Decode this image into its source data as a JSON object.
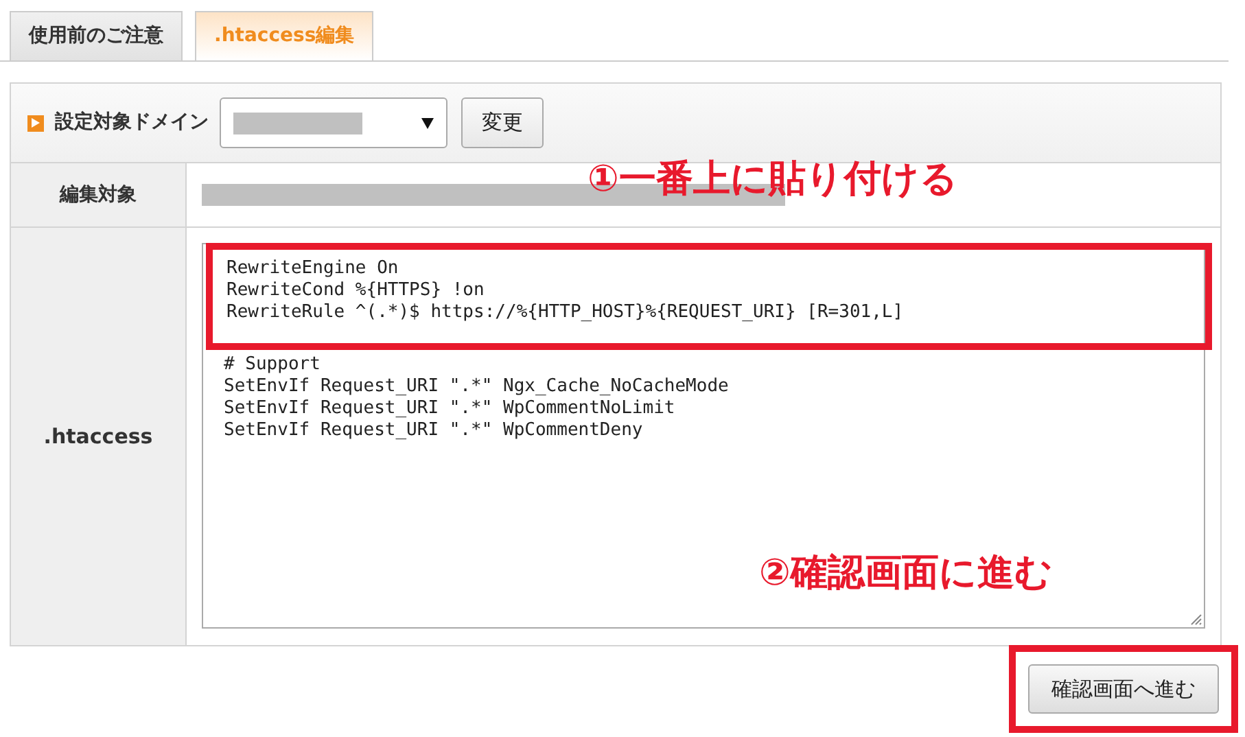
{
  "tabs": [
    {
      "label": "使用前のご注意",
      "selected": false
    },
    {
      "label": ".htaccess編集",
      "selected": true
    }
  ],
  "domain": {
    "label": "設定対象ドメイン",
    "button": "変更"
  },
  "target": {
    "header": "編集対象"
  },
  "editor": {
    "header": ".htaccess",
    "blocks": [
      {
        "highlighted": true,
        "lines": [
          "RewriteEngine On",
          "RewriteCond %{HTTPS} !on",
          "RewriteRule ^(.*)$ https://%{HTTP_HOST}%{REQUEST_URI} [R=301,L]"
        ]
      },
      {
        "highlighted": false,
        "lines": [
          "# Support",
          "SetEnvIf Request_URI \".*\" Ngx_Cache_NoCacheMode",
          "SetEnvIf Request_URI \".*\" WpCommentNoLimit",
          "SetEnvIf Request_URI \".*\" WpCommentDeny"
        ]
      }
    ]
  },
  "annotations": [
    {
      "text": "①一番上に貼り付ける"
    },
    {
      "text": "②確認画面に進む"
    }
  ],
  "submit": {
    "label": "確認画面へ進む",
    "highlighted": true
  }
}
